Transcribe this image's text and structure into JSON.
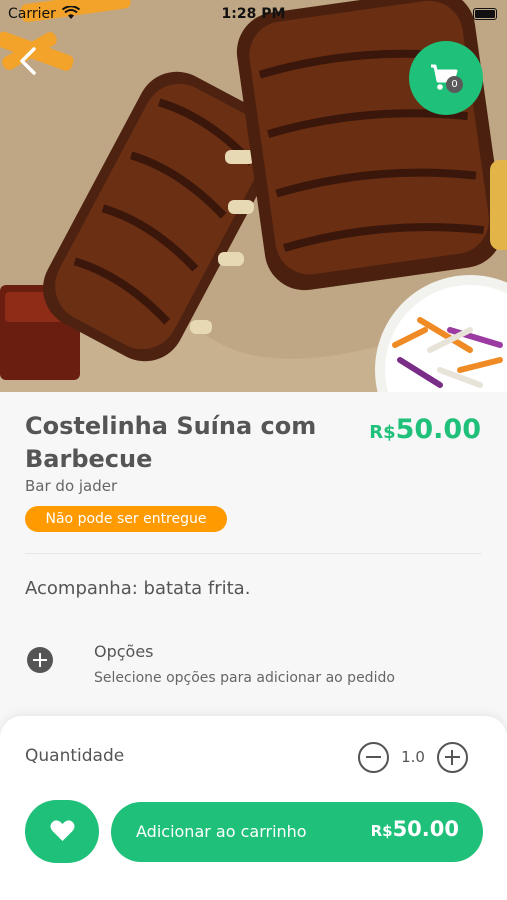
{
  "status_bar": {
    "carrier": "Carrier",
    "time": "1:28 PM"
  },
  "header": {
    "cart_count": "0"
  },
  "product": {
    "name": "Costelinha Suína com Barbecue",
    "price_currency": "R$",
    "price_value": "50.00",
    "store": "Bar do jader",
    "delivery_badge": "Não pode ser entregue",
    "description": "Acompanha: batata frita."
  },
  "options": {
    "title": "Opções",
    "subtitle": "Selecione opções para adicionar ao pedido"
  },
  "bottom_bar": {
    "quantity_label": "Quantidade",
    "quantity_value": "1.0",
    "add_label": "Adicionar ao carrinho",
    "total_currency": "R$",
    "total_value": "50.00"
  },
  "colors": {
    "accent": "#1fc07a",
    "warning": "#ff9a00",
    "text": "#555555"
  },
  "icons": [
    "back-arrow-icon",
    "cart-icon",
    "plus-circle-icon",
    "minus-icon",
    "plus-icon",
    "heart-icon",
    "wifi-icon",
    "battery-icon"
  ]
}
